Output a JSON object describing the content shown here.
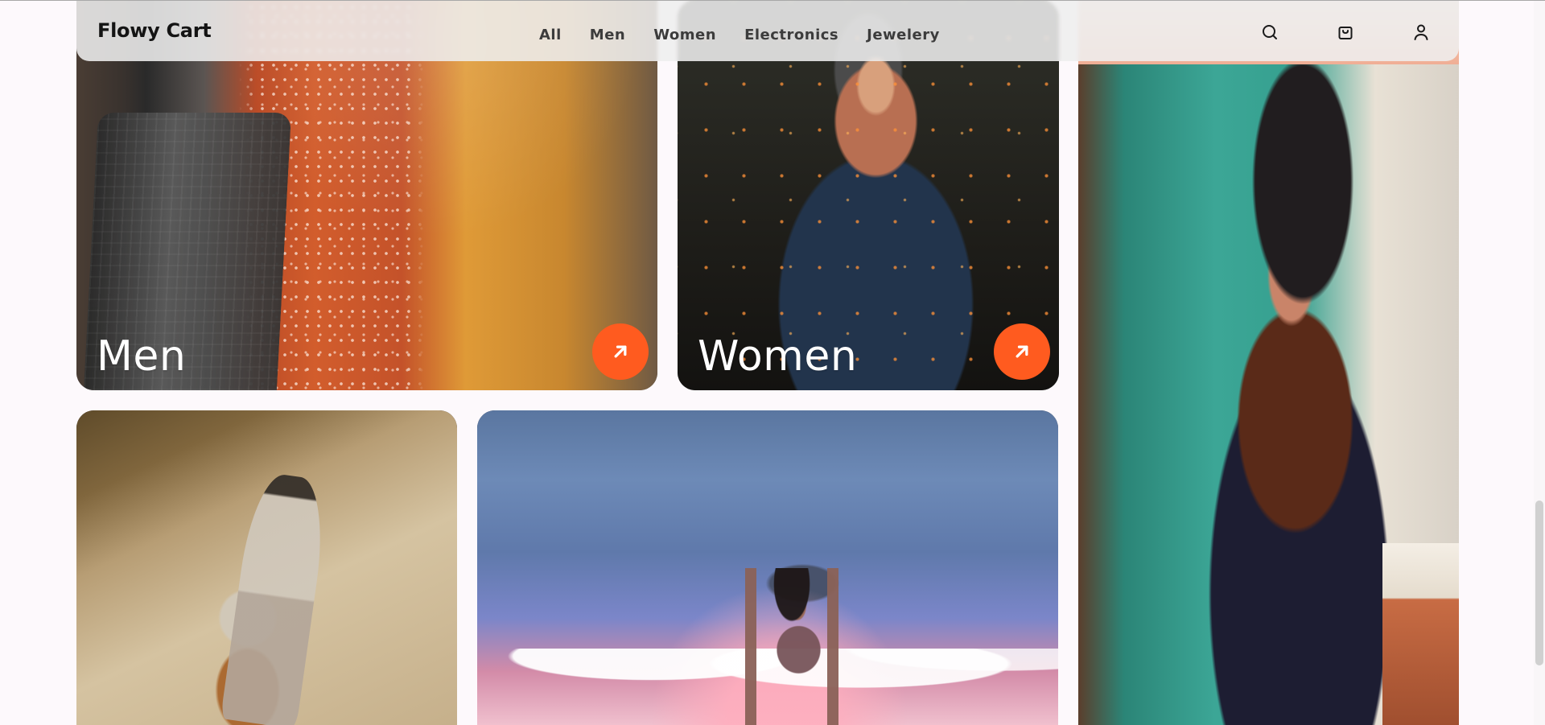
{
  "brand": "Flowy Cart",
  "nav": {
    "links": [
      "All",
      "Men",
      "Women",
      "Electronics",
      "Jewelery"
    ],
    "icons": [
      "search-icon",
      "cart-icon",
      "user-icon"
    ]
  },
  "tiles": {
    "men": {
      "label": "Men"
    },
    "women": {
      "label": "Women"
    }
  },
  "colors": {
    "accent": "#ff5b1f",
    "background": "#fdf9fc"
  }
}
